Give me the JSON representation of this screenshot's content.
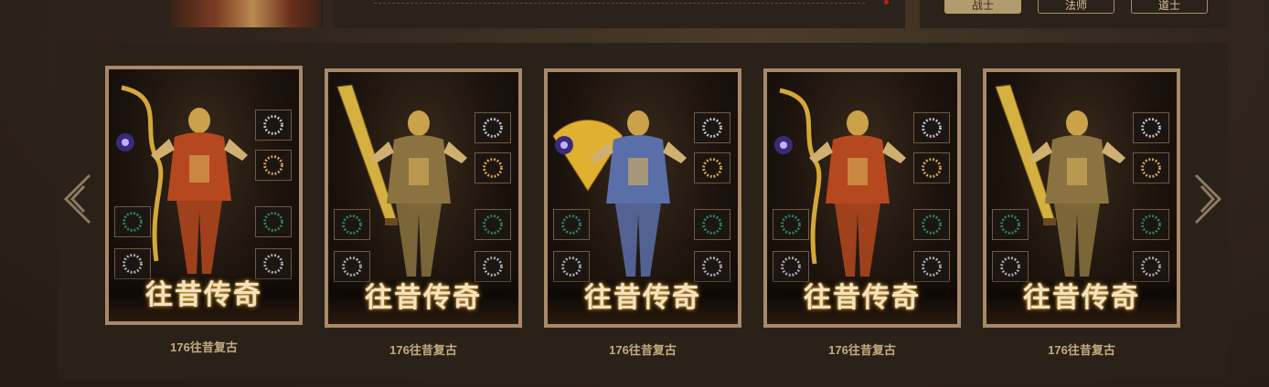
{
  "top_tabs": [
    {
      "label": "战士",
      "active": true
    },
    {
      "label": "法师",
      "active": false
    },
    {
      "label": "道士",
      "active": false
    }
  ],
  "cards": [
    {
      "caption": "176往昔复古",
      "logo": "往昔传奇",
      "hero_color": "#b5481e",
      "weapon": "staff",
      "accent": "#d4a838"
    },
    {
      "caption": "176往昔复古",
      "logo": "往昔传奇",
      "hero_color": "#8a7340",
      "weapon": "sword",
      "accent": "#d4b040"
    },
    {
      "caption": "176往昔复古",
      "logo": "往昔传奇",
      "hero_color": "#5a6fa8",
      "weapon": "fan",
      "accent": "#e0b030"
    },
    {
      "caption": "176往昔复古",
      "logo": "往昔传奇",
      "hero_color": "#b5481e",
      "weapon": "staff",
      "accent": "#d4a838"
    },
    {
      "caption": "176往昔复古",
      "logo": "往昔传奇",
      "hero_color": "#8a7340",
      "weapon": "sword",
      "accent": "#d4b040"
    }
  ],
  "nav": {
    "prev_icon": "chevron-left-icon",
    "next_icon": "chevron-right-icon"
  },
  "colors": {
    "frame": "#a8896a",
    "caption": "#c2ab80",
    "active_tab": "#b39b70"
  }
}
